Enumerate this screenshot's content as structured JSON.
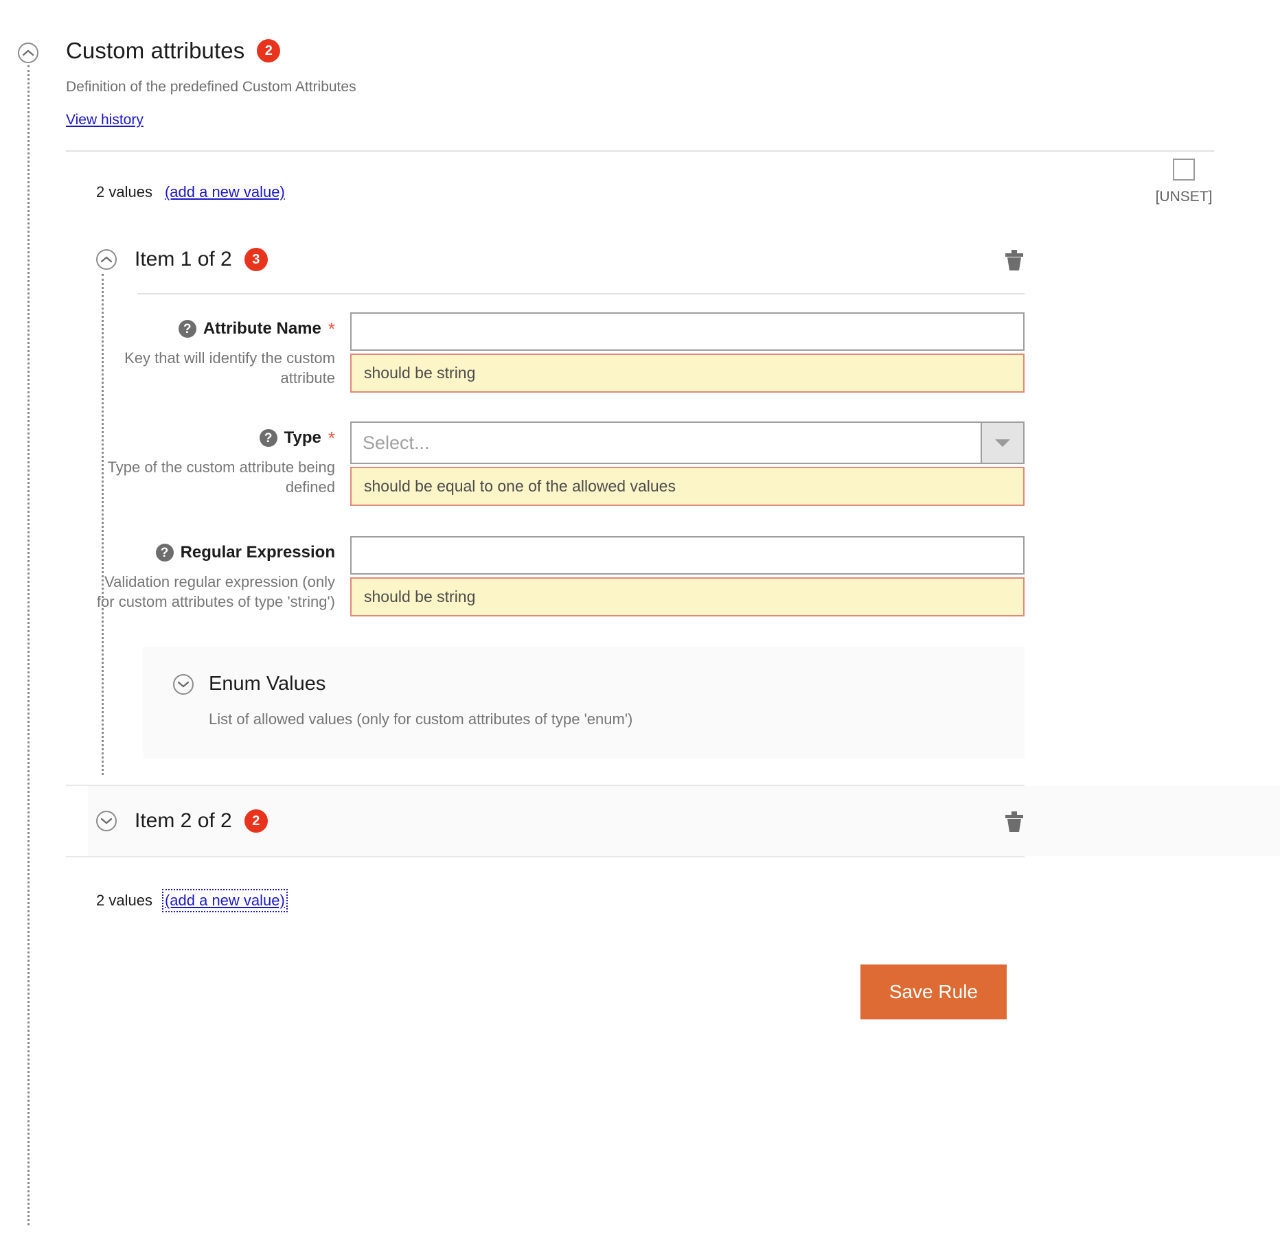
{
  "section": {
    "title": "Custom attributes",
    "badge": "2",
    "description": "Definition of the predefined Custom Attributes",
    "history_link": "View history",
    "collapse_icon": "chevron-up-icon"
  },
  "values_bar": {
    "count_label": "2 values",
    "add_link": "(add a new value)",
    "unset_label": "[UNSET]",
    "unset_checked": false
  },
  "items": [
    {
      "title": "Item 1 of 2",
      "badge": "3",
      "expanded": true,
      "toggle_icon": "chevron-up-icon",
      "delete_icon": "trash-icon",
      "fields": [
        {
          "label": "Attribute Name",
          "required": true,
          "hint": "Key that will identify the custom attribute",
          "control": "text",
          "value": "",
          "placeholder": "",
          "validation": "should be string"
        },
        {
          "label": "Type",
          "required": true,
          "hint": "Type of the custom attribute being defined",
          "control": "select",
          "value": "",
          "placeholder": "Select...",
          "validation": "should be equal to one of the allowed values"
        },
        {
          "label": "Regular Expression",
          "required": false,
          "hint": "Validation regular expression (only for custom attributes of type 'string')",
          "control": "text",
          "value": "",
          "placeholder": "",
          "validation": "should be string"
        }
      ],
      "enum_panel": {
        "title": "Enum Values",
        "description": "List of allowed values (only for custom attributes of type 'enum')",
        "toggle_icon": "chevron-down-icon",
        "expanded": false
      }
    },
    {
      "title": "Item 2 of 2",
      "badge": "2",
      "expanded": false,
      "toggle_icon": "chevron-down-icon",
      "delete_icon": "trash-icon"
    }
  ],
  "bottom_values": {
    "count_label": "2 values",
    "add_link": "(add a new value)",
    "focused": true
  },
  "footer": {
    "save_label": "Save Rule"
  },
  "colors": {
    "badge": "#e8341c",
    "link": "#1a18c6",
    "save_button": "#dd6b33",
    "validation_bg": "#fcf5c8",
    "validation_border": "#e0897a",
    "required_star": "#e8503a"
  }
}
